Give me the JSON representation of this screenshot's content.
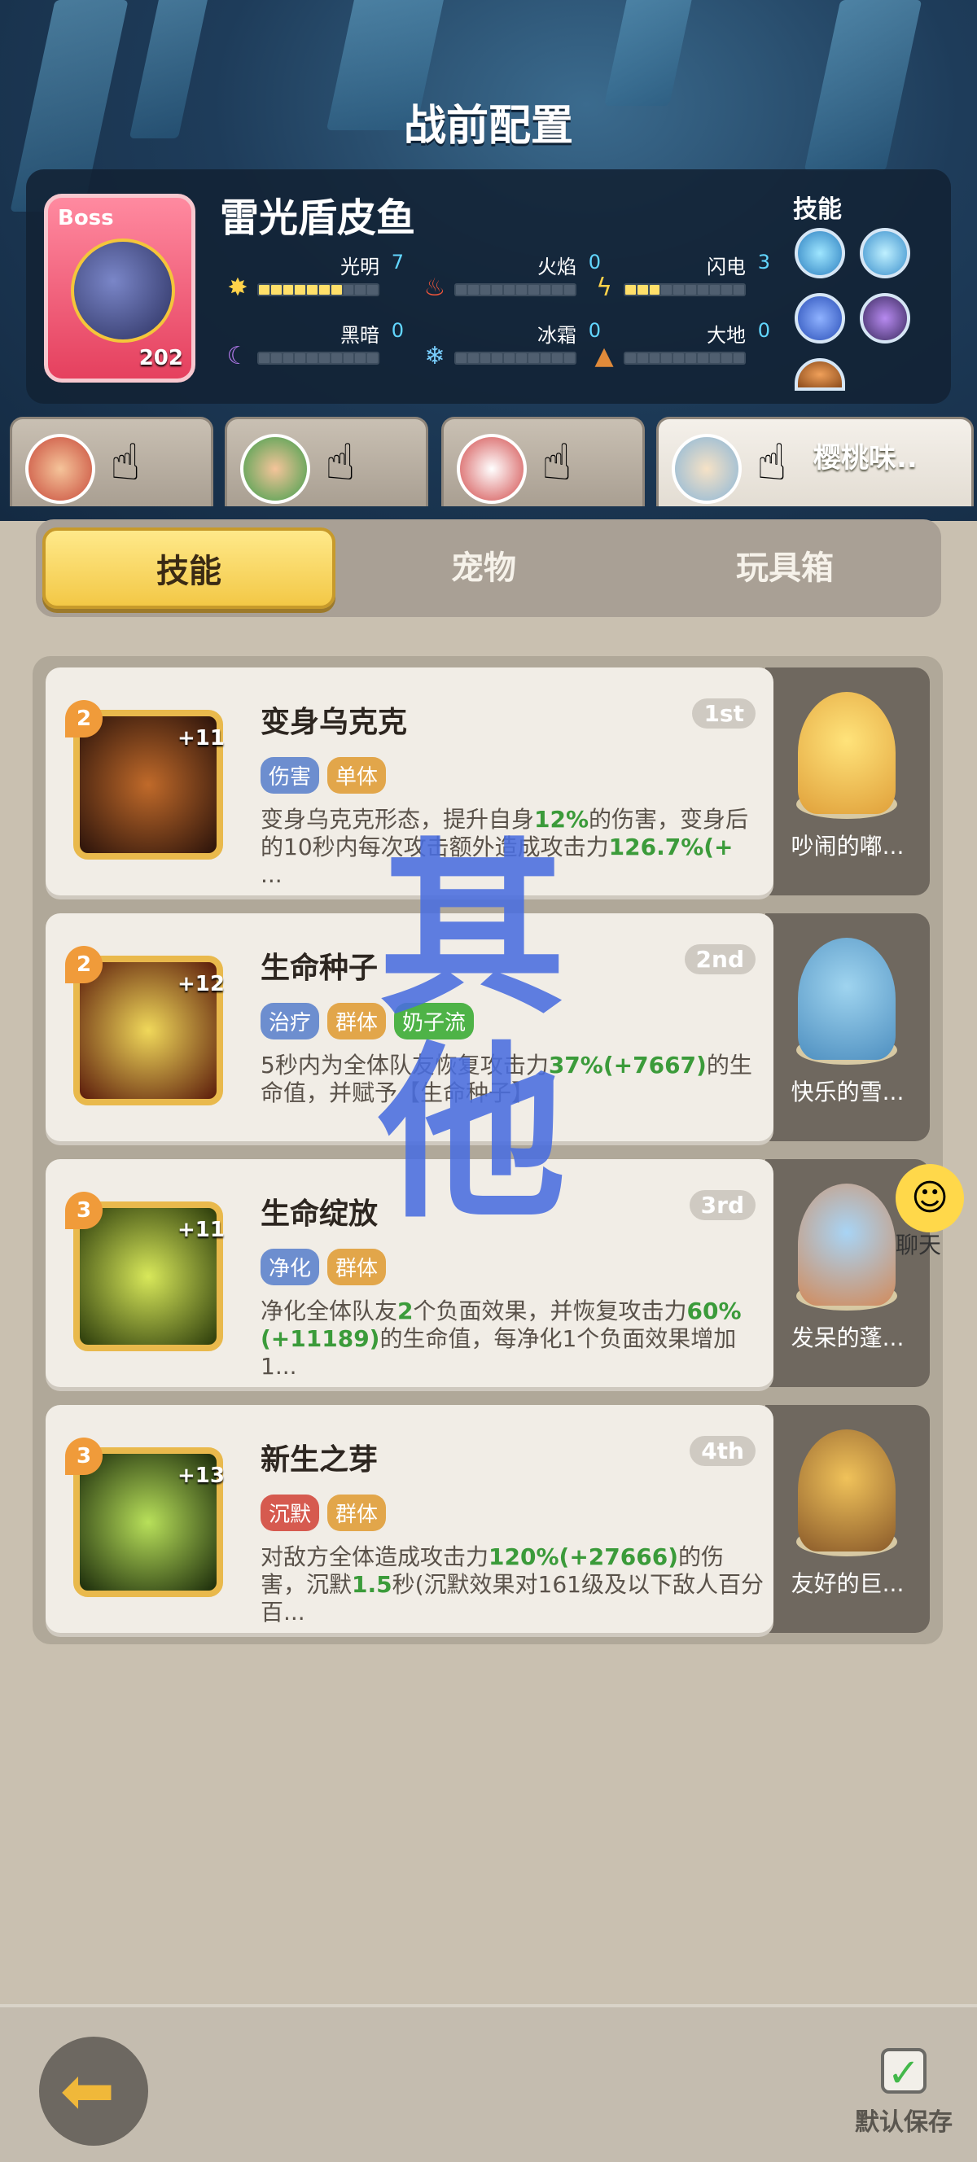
{
  "page_title": "战前配置",
  "boss": {
    "tag": "Boss",
    "name": "雷光盾皮鱼",
    "level": "202",
    "skills_title": "技能",
    "attributes": [
      {
        "label": "光明",
        "value": "7",
        "icon": "sun-icon",
        "level": 7
      },
      {
        "label": "火焰",
        "value": "0",
        "icon": "fire-icon",
        "level": 0
      },
      {
        "label": "闪电",
        "value": "3",
        "icon": "lightning-icon",
        "level": 3
      },
      {
        "label": "黑暗",
        "value": "0",
        "icon": "moon-icon",
        "level": 0
      },
      {
        "label": "冰霜",
        "value": "0",
        "icon": "snowflake-icon",
        "level": 0
      },
      {
        "label": "大地",
        "value": "0",
        "icon": "earth-icon",
        "level": 0
      }
    ]
  },
  "team_tabs": [
    {
      "name": ""
    },
    {
      "name": ""
    },
    {
      "name": ""
    },
    {
      "name": "樱桃味.."
    }
  ],
  "categories": [
    "技能",
    "宠物",
    "玩具箱"
  ],
  "skills": [
    {
      "name": "变身乌克克",
      "rank": "1st",
      "level": "2",
      "bonus": "+11",
      "tags": [
        "伤害",
        "单体"
      ],
      "desc_parts": [
        "变身乌克克形态，提升自身",
        "12%",
        "的伤害，变身后的10秒内每次攻击额外造成攻击力",
        "126.7%(+",
        "..."
      ]
    },
    {
      "name": "生命种子",
      "rank": "2nd",
      "level": "2",
      "bonus": "+12",
      "tags": [
        "治疗",
        "群体",
        "奶子流"
      ],
      "desc_parts": [
        "5秒内为全体队友恢复攻击力",
        "37%(+7667)",
        "的生命值，并赋予【生命种子】",
        "",
        ""
      ]
    },
    {
      "name": "生命绽放",
      "rank": "3rd",
      "level": "3",
      "bonus": "+11",
      "tags": [
        "净化",
        "群体"
      ],
      "desc_parts": [
        "净化全体队友",
        "2",
        "个负面效果，并恢复攻击力",
        "60%(+11189)",
        "的生命值，每净化1个负面效果增加1..."
      ]
    },
    {
      "name": "新生之芽",
      "rank": "4th",
      "level": "3",
      "bonus": "+13",
      "tags": [
        "沉默",
        "群体"
      ],
      "desc_parts": [
        "对敌方全体造成攻击力",
        "120%(+27666)",
        "的伤害，沉默",
        "1.5",
        "秒(沉默效果对161级及以下敌人百分百..."
      ]
    }
  ],
  "pets": [
    "吵闹的嘟...",
    "快乐的雪...",
    "发呆的蓬...",
    "友好的巨..."
  ],
  "overlay_text": "其他",
  "chat_label": "聊天",
  "save_label": "默认保存",
  "colors": {
    "accent": "#f3c846",
    "green_value": "#3b9b3a",
    "overlay": "#4a6ee0"
  }
}
